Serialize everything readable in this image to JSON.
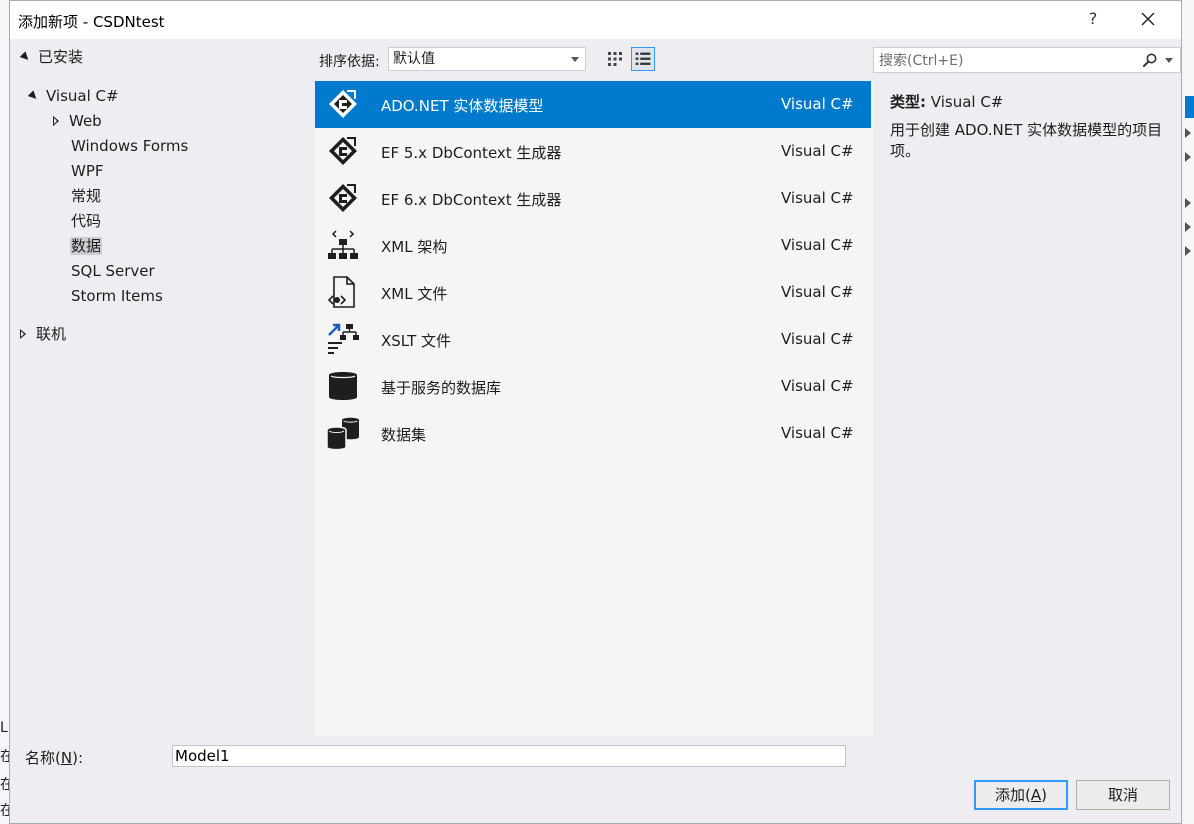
{
  "window": {
    "title": "添加新项 - CSDNtest",
    "help_label": "?"
  },
  "tree": {
    "installed": "已安装",
    "visual_csharp": "Visual C#",
    "children": [
      "Web",
      "Windows Forms",
      "WPF",
      "常规",
      "代码",
      "数据",
      "SQL Server",
      "Storm Items"
    ],
    "selected": "数据",
    "online": "联机"
  },
  "sort": {
    "label": "排序依据:",
    "value": "默认值"
  },
  "search": {
    "placeholder": "搜索(Ctrl+E)"
  },
  "templates": [
    {
      "name": "ADO.NET 实体数据模型",
      "lang": "Visual C#",
      "icon": "entity-model-icon"
    },
    {
      "name": "EF 5.x DbContext 生成器",
      "lang": "Visual C#",
      "icon": "entity-model-icon"
    },
    {
      "name": "EF 6.x DbContext 生成器",
      "lang": "Visual C#",
      "icon": "entity-model-icon"
    },
    {
      "name": "XML 架构",
      "lang": "Visual C#",
      "icon": "xml-schema-icon"
    },
    {
      "name": "XML 文件",
      "lang": "Visual C#",
      "icon": "xml-file-icon"
    },
    {
      "name": "XSLT 文件",
      "lang": "Visual C#",
      "icon": "xslt-file-icon"
    },
    {
      "name": "基于服务的数据库",
      "lang": "Visual C#",
      "icon": "database-icon"
    },
    {
      "name": "数据集",
      "lang": "Visual C#",
      "icon": "dataset-icon"
    }
  ],
  "details": {
    "type_label": "类型:",
    "type_value": "Visual C#",
    "description": "用于创建 ADO.NET 实体数据模型的项目项。"
  },
  "name_field": {
    "label_prefix": "名称(",
    "label_key": "N",
    "label_suffix": "):",
    "value": "Model1"
  },
  "buttons": {
    "add_prefix": "添加(",
    "add_key": "A",
    "add_suffix": ")",
    "cancel": "取消"
  },
  "colors": {
    "selection": "#007acc",
    "accent": "#3399ff"
  }
}
